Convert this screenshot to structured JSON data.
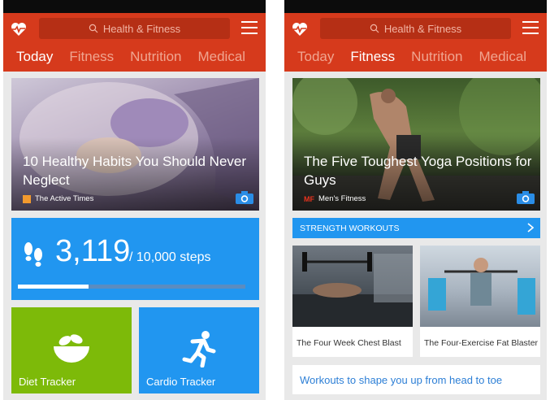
{
  "header": {
    "search_placeholder": "Health & Fitness"
  },
  "tabs": [
    "Today",
    "Fitness",
    "Nutrition",
    "Medical"
  ],
  "left_screen": {
    "active_tab": "Today",
    "hero": {
      "title": "10 Healthy Habits You Should Never Neglect",
      "source": "The Active Times"
    },
    "steps": {
      "count": "3,119",
      "goal_text": "/ 10,000 steps",
      "progress_fraction": 0.31
    },
    "tiles": {
      "diet_label": "Diet Tracker",
      "cardio_label": "Cardio Tracker"
    }
  },
  "right_screen": {
    "active_tab": "Fitness",
    "hero": {
      "title": "The Five Toughest Yoga Positions for Guys",
      "source_badge": "MF",
      "source": "Men's Fitness"
    },
    "section_title": "STRENGTH WORKOUTS",
    "cards": [
      {
        "title": "The Four Week Chest Blast"
      },
      {
        "title": "The Four-Exercise Fat Blaster"
      }
    ],
    "link_text": "Workouts to shape you up from head to toe"
  },
  "colors": {
    "brand_red": "#d63a1c",
    "accent_blue": "#2196f0",
    "diet_green": "#7dba09"
  },
  "icons": [
    "heart-pulse-icon",
    "search-icon",
    "menu-icon",
    "camera-icon",
    "footprints-icon",
    "salad-bowl-icon",
    "running-icon",
    "chevron-right-icon"
  ]
}
